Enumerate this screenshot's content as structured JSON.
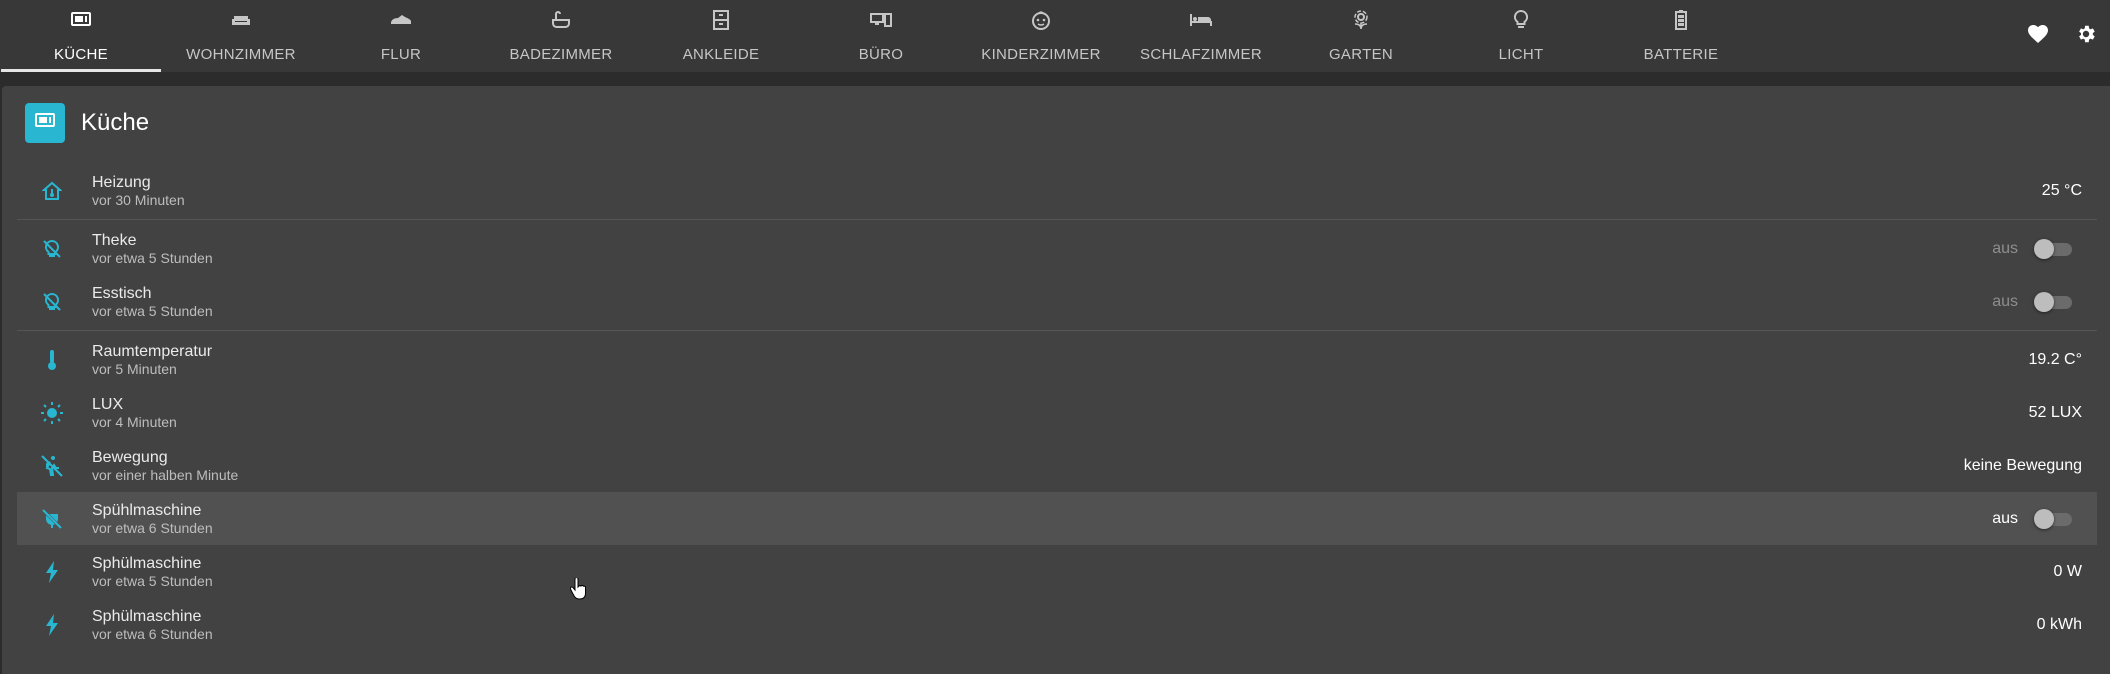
{
  "nav": {
    "tabs": [
      {
        "label": "KÜCHE",
        "icon": "microwave-icon",
        "active": true
      },
      {
        "label": "WOHNZIMMER",
        "icon": "sofa-icon",
        "active": false
      },
      {
        "label": "FLUR",
        "icon": "shoe-icon",
        "active": false
      },
      {
        "label": "BADEZIMMER",
        "icon": "bathtub-icon",
        "active": false
      },
      {
        "label": "ANKLEIDE",
        "icon": "wardrobe-icon",
        "active": false
      },
      {
        "label": "BÜRO",
        "icon": "desk-icon",
        "active": false
      },
      {
        "label": "KINDERZIMMER",
        "icon": "baby-face-icon",
        "active": false
      },
      {
        "label": "SCHLAFZIMMER",
        "icon": "bed-icon",
        "active": false
      },
      {
        "label": "GARTEN",
        "icon": "flower-icon",
        "active": false
      },
      {
        "label": "LICHT",
        "icon": "lightbulb-icon",
        "active": false
      },
      {
        "label": "BATTERIE",
        "icon": "battery-icon",
        "active": false
      }
    ],
    "actions": [
      {
        "icon": "heart-icon"
      },
      {
        "icon": "gear-icon"
      }
    ]
  },
  "card": {
    "title": "Küche",
    "icon": "microwave-icon",
    "accent": "#29b6d0",
    "rows": [
      {
        "name": "Heizung",
        "time": "vor 30 Minuten",
        "value": "25 °C",
        "icon": "home-thermostat-icon"
      },
      {
        "name": "Theke",
        "time": "vor etwa 5 Stunden",
        "state": "aus",
        "icon": "lightbulb-off-icon"
      },
      {
        "name": "Esstisch",
        "time": "vor etwa 5 Stunden",
        "state": "aus",
        "icon": "lightbulb-off-icon"
      },
      {
        "name": "Raumtemperatur",
        "time": "vor 5 Minuten",
        "value": "19.2 C°",
        "icon": "thermometer-icon"
      },
      {
        "name": "LUX",
        "time": "vor 4 Minuten",
        "value": "52 LUX",
        "icon": "brightness-icon"
      },
      {
        "name": "Bewegung",
        "time": "vor einer halben Minute",
        "value": "keine Bewegung",
        "icon": "motion-off-icon"
      },
      {
        "name": "Spühlmaschine",
        "time": "vor etwa 6 Stunden",
        "state": "aus",
        "icon": "power-plug-off-icon"
      },
      {
        "name": "Sphülmaschine",
        "time": "vor etwa 5 Stunden",
        "value": "0 W",
        "icon": "flash-icon"
      },
      {
        "name": "Sphülmaschine",
        "time": "vor etwa 6 Stunden",
        "value": "0 kWh",
        "icon": "flash-icon"
      }
    ]
  }
}
